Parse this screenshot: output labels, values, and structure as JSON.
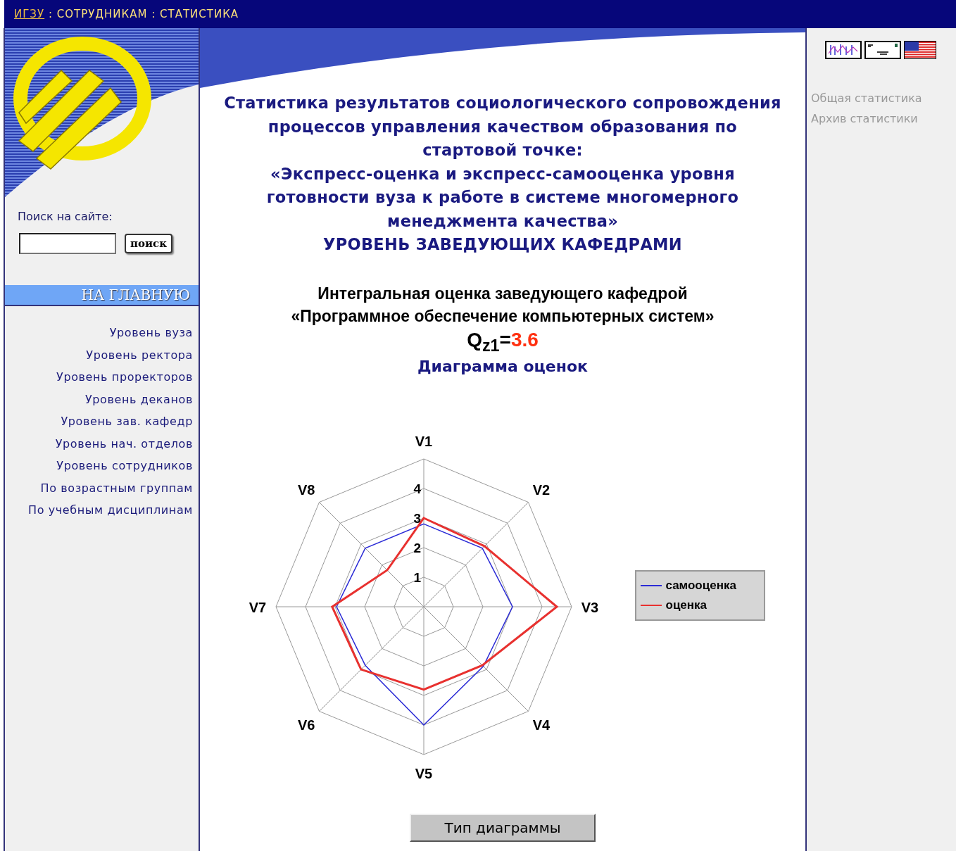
{
  "breadcrumb": {
    "home_link": "ИГЗУ",
    "path": " : СОТРУДНИКАМ : СТАТИСТИКА"
  },
  "search": {
    "label": "Поиск на сайте:",
    "button": "поиск"
  },
  "home_bar": "НА ГЛАВНУЮ",
  "nav_links": [
    "Уровень вуза",
    "Уровень ректора",
    "Уровень проректоров",
    "Уровень деканов",
    "Уровень зав. кафедр",
    "Уровень нач. отделов",
    "Уровень сотрудников",
    "По возрастным группам",
    "По учебным дисциплинам"
  ],
  "right_links": [
    "Общая статистика",
    "Архив статистики"
  ],
  "title_lines": [
    "Статистика результатов социологического сопровождения",
    "процессов управления качеством образования по",
    "стартовой точке:",
    "«Экспресс-оценка и экспресс-самооценка уровня",
    "готовности вуза к работе в системе многомерного",
    "менеджмента качества»",
    "УРОВЕНЬ ЗАВЕДУЮЩИХ КАФЕДРАМИ"
  ],
  "subtitle_lines": [
    "Интегральная оценка заведующего кафедрой",
    "«Программное обеспечение компьютерных систем»"
  ],
  "q_label": "Q$_{z1}$=",
  "q_value": "3.6",
  "diagram_title": "Диаграмма оценок",
  "chart_data": {
    "type": "radar",
    "legend": "right",
    "categories": [
      "V1",
      "V2",
      "V3",
      "V4",
      "V5",
      "V6",
      "V7",
      "V8"
    ],
    "ylim": [
      0,
      5
    ],
    "yticks": [
      1,
      2,
      3,
      4
    ],
    "series": [
      {
        "name": "самооценка",
        "color": "#2b2bd6",
        "values": [
          2.8,
          2.8,
          3.0,
          2.85,
          4.0,
          2.8,
          2.95,
          2.8
        ]
      },
      {
        "name": "оценка",
        "color": "#e8312f",
        "values": [
          3.0,
          2.9,
          4.5,
          2.8,
          2.8,
          3.0,
          3.1,
          1.75
        ]
      }
    ]
  },
  "chart_type_button": "Тип диаграммы"
}
